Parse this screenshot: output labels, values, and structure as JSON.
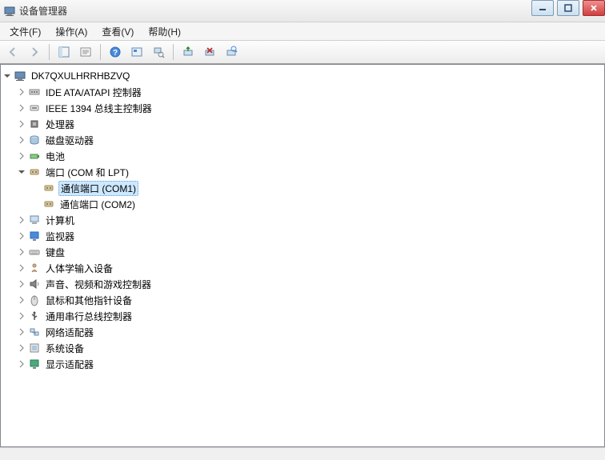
{
  "window": {
    "title": "设备管理器"
  },
  "menubar": [
    {
      "label": "文件(F)"
    },
    {
      "label": "操作(A)"
    },
    {
      "label": "查看(V)"
    },
    {
      "label": "帮助(H)"
    }
  ],
  "tree": {
    "root": {
      "label": "DK7QXULHRRHBZVQ",
      "icon": "computer",
      "expanded": true,
      "children": [
        {
          "label": "IDE ATA/ATAPI 控制器",
          "icon": "ide",
          "expanded": false,
          "hasChildren": true
        },
        {
          "label": "IEEE 1394 总线主控制器",
          "icon": "ieee1394",
          "expanded": false,
          "hasChildren": true
        },
        {
          "label": "处理器",
          "icon": "cpu",
          "expanded": false,
          "hasChildren": true
        },
        {
          "label": "磁盘驱动器",
          "icon": "disk",
          "expanded": false,
          "hasChildren": true
        },
        {
          "label": "电池",
          "icon": "battery",
          "expanded": false,
          "hasChildren": true
        },
        {
          "label": "端口 (COM 和 LPT)",
          "icon": "port",
          "expanded": true,
          "hasChildren": true,
          "children": [
            {
              "label": "通信端口 (COM1)",
              "icon": "port",
              "selected": true
            },
            {
              "label": "通信端口 (COM2)",
              "icon": "port"
            }
          ]
        },
        {
          "label": "计算机",
          "icon": "pc",
          "expanded": false,
          "hasChildren": true
        },
        {
          "label": "监视器",
          "icon": "monitor",
          "expanded": false,
          "hasChildren": true
        },
        {
          "label": "键盘",
          "icon": "keyboard",
          "expanded": false,
          "hasChildren": true
        },
        {
          "label": "人体学输入设备",
          "icon": "hid",
          "expanded": false,
          "hasChildren": true
        },
        {
          "label": "声音、视频和游戏控制器",
          "icon": "sound",
          "expanded": false,
          "hasChildren": true
        },
        {
          "label": "鼠标和其他指针设备",
          "icon": "mouse",
          "expanded": false,
          "hasChildren": true
        },
        {
          "label": "通用串行总线控制器",
          "icon": "usb",
          "expanded": false,
          "hasChildren": true
        },
        {
          "label": "网络适配器",
          "icon": "network",
          "expanded": false,
          "hasChildren": true
        },
        {
          "label": "系统设备",
          "icon": "system",
          "expanded": false,
          "hasChildren": true
        },
        {
          "label": "显示适配器",
          "icon": "display",
          "expanded": false,
          "hasChildren": true
        }
      ]
    }
  }
}
